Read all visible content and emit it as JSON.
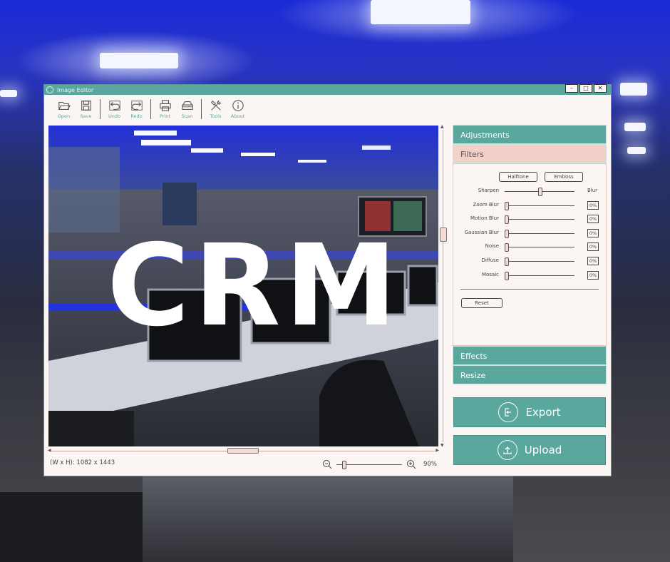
{
  "window": {
    "title": "Image Editor",
    "controls": [
      "–",
      "□",
      "✕"
    ]
  },
  "toolbar": {
    "items": [
      {
        "label": "Open",
        "icon": "folder-open-icon"
      },
      {
        "label": "Save",
        "icon": "floppy-disk-icon"
      },
      {
        "label": "Undo",
        "icon": "undo-icon"
      },
      {
        "label": "Redo",
        "icon": "redo-icon"
      },
      {
        "label": "Print",
        "icon": "printer-icon"
      },
      {
        "label": "Scan",
        "icon": "scanner-icon"
      },
      {
        "label": "Tools",
        "icon": "tools-icon"
      },
      {
        "label": "About",
        "icon": "info-icon"
      }
    ]
  },
  "status": {
    "dimensions": "(W x H): 1082 x 1443",
    "zoom": "90%"
  },
  "panel": {
    "adjustments": "Adjustments",
    "filters": "Filters",
    "effects": "Effects",
    "resize": "Resize",
    "halftone": "Halftone",
    "emboss": "Emboss",
    "sharpen": "Sharpen",
    "blur": "Blur",
    "sliders": [
      {
        "label": "Zoom Blur",
        "value": "0%"
      },
      {
        "label": "Motion Blur",
        "value": "0%"
      },
      {
        "label": "Gaussian Blur",
        "value": "0%"
      },
      {
        "label": "Noise",
        "value": "0%"
      },
      {
        "label": "Diffuse",
        "value": "0%"
      },
      {
        "label": "Mosaic",
        "value": "0%"
      }
    ],
    "reset": "Reset"
  },
  "actions": {
    "export": "Export",
    "upload": "Upload"
  },
  "overlay": {
    "text": "CRM"
  },
  "colors": {
    "accent": "#5aa79e",
    "open_section": "#f3d1c9",
    "window_bg": "#fbf6f4"
  }
}
